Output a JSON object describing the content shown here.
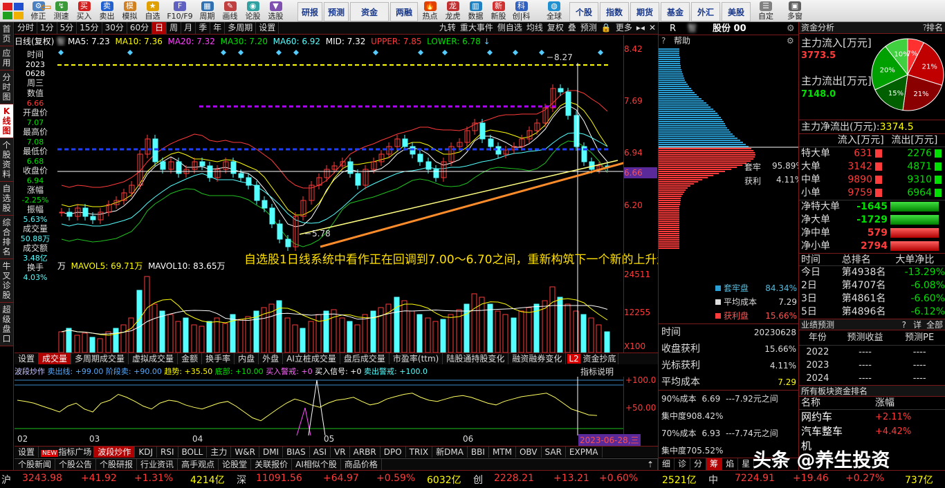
{
  "toolbar": {
    "buttons": [
      "修正",
      "测速",
      "买入",
      "卖出",
      "模拟",
      "自选",
      "F10/F9",
      "周期",
      "画线",
      "论股",
      "选股"
    ],
    "text_buttons": [
      "研报",
      "预测",
      "资金",
      "两融",
      "热点",
      "龙虎",
      "数据",
      "新股",
      "创|科"
    ],
    "right_buttons": [
      "全球",
      "个股",
      "指数",
      "期货",
      "基金",
      "外汇",
      "美股",
      "自定",
      "多窗"
    ]
  },
  "left_tabs": [
    "首页",
    "应用",
    "分时图",
    "K线图",
    "个股资料",
    "自选股",
    "综合排名",
    "牛叉诊股",
    "超级盘口"
  ],
  "period_bar": {
    "items": [
      "分时",
      "1分",
      "5分",
      "15分",
      "30分",
      "60分",
      "日",
      "周",
      "月",
      "季",
      "年",
      "多周期",
      "设置"
    ],
    "active": "日",
    "right_items": [
      "九转",
      "重大事件",
      "侧自选",
      "均线",
      "复权",
      "叠",
      "预测",
      "更多"
    ]
  },
  "ma_bar": {
    "label": "日线(复权)",
    "stock": "智",
    "ma5": "MA5: 7.23",
    "ma10": "MA10: 7.36",
    "ma20": "MA20: 7.32",
    "ma30": "MA30: 7.20",
    "ma60": "MA60: 6.92",
    "mid": "MID: 7.32",
    "upper": "UPPER: 7.85",
    "lower": "LOWER: 6.78"
  },
  "info_panel": {
    "time_label": "时间",
    "date1": "2023",
    "date2": "0628",
    "weekday": "周三",
    "num_label": "数值",
    "num_val": "6.66",
    "open_label": "开盘价",
    "open_val": "7.07",
    "high_label": "最高价",
    "high_val": "7.08",
    "low_label": "最低价",
    "low_val": "6.68",
    "close_label": "收盘价",
    "close_val": "6.94",
    "chg_label": "涨幅",
    "chg_val": "-2.25%",
    "amp_label": "振幅",
    "amp_val": "5.63%",
    "vol_label": "成交量",
    "vol_val": "50.88万",
    "amt_label": "成交额",
    "amt_val": "3.48亿",
    "turn_label": "换手",
    "turn_val": "4.03%"
  },
  "price_scale": [
    "8.42",
    "7.69",
    "6.94",
    "6.66",
    "6.20"
  ],
  "annotations": {
    "high_mark": "8.27",
    "low_mark": "5.78",
    "headline": "自选股1日线系统中看作正在回调到7.00～6.70之间，重新构筑下一个新的上升趋势。",
    "vol_unit": "万",
    "mavol5": "MAVOL5: 69.71万",
    "mavol10": "MAVOL10: 83.65万",
    "vol_ticks": [
      "24511",
      "12255",
      "X100"
    ]
  },
  "ind_tabs1": {
    "items": [
      "设置",
      "成交量",
      "多周期成交量",
      "虚拟成交量",
      "金额",
      "换手率",
      "内盘",
      "外盘",
      "AI立桩成交量",
      "盘后成交量",
      "市盈率(ttm)",
      "陆股通持股变化",
      "融资融券变化",
      "资金抄底"
    ],
    "active": "成交量",
    "badge": "L2"
  },
  "osc_bar": {
    "name": "波段炒作",
    "sell": "卖出线: +99.00",
    "stage": "阶段卖: +90.00",
    "trend": "趋势: +35.50",
    "bottom": "底部: +10.00",
    "buy_warn": "买入警戒: +0",
    "buy_sig": "买入信号: +0",
    "sell_warn": "卖出警戒: +100.0",
    "explain": "指标说明",
    "ticks": [
      "+100.0",
      "+50.00"
    ]
  },
  "date_bar": {
    "labels": [
      "02",
      "03",
      "04",
      "05",
      "06"
    ],
    "current": "2023-06-28,三"
  },
  "ind_tabs2": {
    "items": [
      "设置",
      "指标广场",
      "波段炒作",
      "KDJ",
      "RSI",
      "BOLL",
      "主力",
      "W&R",
      "DMI",
      "BIAS",
      "ASI",
      "VR",
      "ARBR",
      "DPO",
      "TRIX",
      "新DMA",
      "BBI",
      "MTM",
      "OBV",
      "SAR",
      "EXPMA"
    ],
    "active": "波段炒作",
    "new_badge": "NEW"
  },
  "news_tabs": [
    "个股新闻",
    "个股公告",
    "个股研报",
    "行业资讯",
    "高手观点",
    "论股堂",
    "关联报价",
    "AI相似个股",
    "商品价格"
  ],
  "chips": {
    "header_r": "R",
    "title": "智",
    "title2": "股份 00",
    "help": "帮助",
    "lock_label": "套牢",
    "lock_pct": "95.89%",
    "profit_label": "获利",
    "profit_pct": "4.11%",
    "legend": [
      {
        "label": "套牢盘",
        "val": "84.34%",
        "color": "#2a9fd6"
      },
      {
        "label": "平均成本",
        "val": "7.29",
        "color": "#dddddd"
      },
      {
        "label": "获利盘",
        "val": "15.66%",
        "color": "#ff3b3b"
      }
    ],
    "rows": [
      {
        "k": "时间",
        "v": "20230628"
      },
      {
        "k": "收盘获利",
        "v": "15.66%"
      },
      {
        "k": "光标获利",
        "v": "4.11%"
      },
      {
        "k": "平均成本",
        "v": "7.29"
      }
    ],
    "c90": "90%成本",
    "c90v": "6.69",
    "c90r": "---7.92元之间",
    "conc90": "集中度90",
    "conc90v": "8.42%",
    "c70": "70%成本",
    "c70v": "6.93",
    "c70r": "---7.74元之间",
    "conc70": "集中度70",
    "conc70v": "5.52%",
    "bottom_tabs": [
      "细",
      "诊",
      "分",
      "筹",
      "焰",
      "星"
    ],
    "active_tab": "筹"
  },
  "right": {
    "fund_title": "资金分析",
    "rank_btn": "排名",
    "inflow_label": "主力流入[万元]",
    "inflow_val": "3773.5",
    "outflow_label": "主力流出[万元]",
    "outflow_val": "7148.0",
    "net_label": "主力净流出(万元):",
    "net_val": "3374.5",
    "pie": [
      {
        "label": "7%",
        "pct": 7,
        "color": "#ff3030"
      },
      {
        "label": "21%",
        "pct": 21,
        "color": "#c00000"
      },
      {
        "label": "21%",
        "pct": 21,
        "color": "#8a0000"
      },
      {
        "label": "15%",
        "pct": 15,
        "color": "#006000"
      },
      {
        "label": "20%",
        "pct": 20,
        "color": "#00a000"
      },
      {
        "label": "10%",
        "pct": 10,
        "color": "#40d040"
      }
    ],
    "flow_head": [
      "流入[万元]",
      "流出[万元]"
    ],
    "flow_rows": [
      {
        "k": "特大单",
        "in": "631",
        "out": "2276"
      },
      {
        "k": "大单",
        "in": "3142",
        "out": "4871"
      },
      {
        "k": "中单",
        "in": "9890",
        "out": "9310"
      },
      {
        "k": "小单",
        "in": "9759",
        "out": "6964"
      }
    ],
    "net_rows": [
      {
        "k": "净特大单",
        "v": "-1645",
        "neg": true
      },
      {
        "k": "净大单",
        "v": "-1729",
        "neg": true
      },
      {
        "k": "净中单",
        "v": "579",
        "neg": false
      },
      {
        "k": "净小单",
        "v": "2794",
        "neg": false
      }
    ],
    "rank_head": [
      "时间",
      "总排名",
      "大单净比"
    ],
    "rank_rows": [
      {
        "d": "今日",
        "r": "第4938名",
        "p": "-13.29%"
      },
      {
        "d": "2日",
        "r": "第4707名",
        "p": "-6.08%"
      },
      {
        "d": "3日",
        "r": "第4861名",
        "p": "-6.60%"
      },
      {
        "d": "5日",
        "r": "第4896名",
        "p": "-6.12%"
      }
    ],
    "perf_title": "业绩预测",
    "perf_btns": [
      "?",
      "详",
      "全部"
    ],
    "perf_head": [
      "年份",
      "预测收益",
      "预测PE"
    ],
    "perf_rows": [
      {
        "y": "2022",
        "e": "----",
        "pe": "----"
      },
      {
        "y": "2023",
        "e": "----",
        "pe": "----"
      },
      {
        "y": "2024",
        "e": "----",
        "pe": "----"
      }
    ],
    "sector_title": "所有板块资金排名",
    "sector_head": [
      "名称",
      "涨幅"
    ],
    "sectors": [
      {
        "n": "网约车",
        "v": "+2.11%"
      },
      {
        "n": "汽车整车",
        "v": "+4.42%"
      },
      {
        "n": "机",
        "v": ""
      }
    ]
  },
  "status": {
    "sh_label": "沪",
    "sh_idx": "3243.98",
    "sh_chg": "+41.92",
    "sh_pct": "+1.31%",
    "sh_amt": "4214亿",
    "sz_label": "深",
    "sz_idx": "11091.56",
    "sz_chg": "+64.97",
    "sz_pct": "+0.59%",
    "sz_amt": "6032亿",
    "cy_label": "创",
    "cy_idx": "2228.21",
    "cy_chg": "+13.21",
    "cy_pct": "+0.60%",
    "cy_amt": "2521亿",
    "zz_label": "中",
    "zz_idx": "7224.91",
    "zz_chg": "+19.46",
    "zz_pct": "+0.27%",
    "zz_amt": "737亿"
  },
  "watermark": "头条 @养生投资"
}
